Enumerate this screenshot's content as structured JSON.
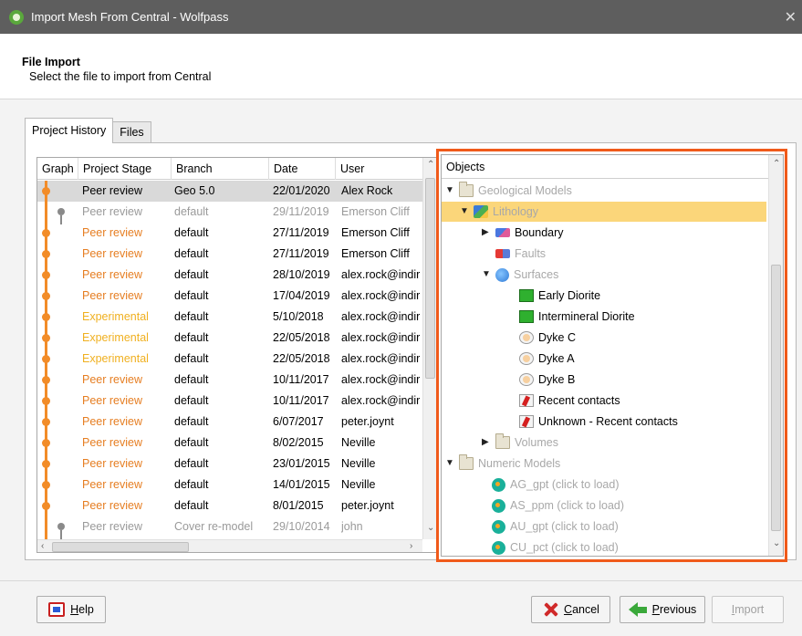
{
  "window": {
    "title": "Import Mesh From Central - Wolfpass",
    "close_icon": "close-icon"
  },
  "header": {
    "title": "File Import",
    "subtitle": "Select the file to import from Central"
  },
  "tabs": [
    {
      "label": "Project History",
      "active": true
    },
    {
      "label": "Files",
      "active": false
    }
  ],
  "history": {
    "columns": [
      "Graph",
      "Project Stage",
      "Branch",
      "Date",
      "User"
    ],
    "rows": [
      {
        "stage": "Peer review",
        "branch": "Geo 5.0",
        "date": "22/01/2020",
        "user": "Alex Rock",
        "style": "selected"
      },
      {
        "stage": "Peer review",
        "branch": "default",
        "date": "29/11/2019",
        "user": "Emerson Cliff",
        "style": "muted"
      },
      {
        "stage": "Peer review",
        "branch": "default",
        "date": "27/11/2019",
        "user": "Emerson Cliff",
        "style": "peer"
      },
      {
        "stage": "Peer review",
        "branch": "default",
        "date": "27/11/2019",
        "user": "Emerson Cliff",
        "style": "peer"
      },
      {
        "stage": "Peer review",
        "branch": "default",
        "date": "28/10/2019",
        "user": "alex.rock@indir",
        "style": "peer"
      },
      {
        "stage": "Peer review",
        "branch": "default",
        "date": "17/04/2019",
        "user": "alex.rock@indir",
        "style": "peer"
      },
      {
        "stage": "Experimental",
        "branch": "default",
        "date": "5/10/2018",
        "user": "alex.rock@indir",
        "style": "exp"
      },
      {
        "stage": "Experimental",
        "branch": "default",
        "date": "22/05/2018",
        "user": "alex.rock@indir",
        "style": "exp"
      },
      {
        "stage": "Experimental",
        "branch": "default",
        "date": "22/05/2018",
        "user": "alex.rock@indir",
        "style": "exp"
      },
      {
        "stage": "Peer review",
        "branch": "default",
        "date": "10/11/2017",
        "user": "alex.rock@indir",
        "style": "peer"
      },
      {
        "stage": "Peer review",
        "branch": "default",
        "date": "10/11/2017",
        "user": "alex.rock@indir",
        "style": "peer"
      },
      {
        "stage": "Peer review",
        "branch": "default",
        "date": "6/07/2017",
        "user": "peter.joynt",
        "style": "peer"
      },
      {
        "stage": "Peer review",
        "branch": "default",
        "date": "8/02/2015",
        "user": "Neville",
        "style": "peer"
      },
      {
        "stage": "Peer review",
        "branch": "default",
        "date": "23/01/2015",
        "user": "Neville",
        "style": "peer"
      },
      {
        "stage": "Peer review",
        "branch": "default",
        "date": "14/01/2015",
        "user": "Neville",
        "style": "peer"
      },
      {
        "stage": "Peer review",
        "branch": "default",
        "date": "8/01/2015",
        "user": "peter.joynt",
        "style": "peer"
      },
      {
        "stage": "Peer review",
        "branch": "Cover re-model",
        "date": "29/10/2014",
        "user": "john",
        "style": "muted"
      }
    ]
  },
  "objects": {
    "header": "Objects",
    "items": [
      {
        "label": "Geological Models",
        "icon": "folder-icon",
        "toggle": "▼",
        "dim": true
      },
      {
        "label": "Lithology",
        "icon": "lithology-icon",
        "toggle": "▼",
        "dim": true,
        "highlight": true
      },
      {
        "label": "Boundary",
        "icon": "boundary-icon",
        "toggle": "▶",
        "dim": false
      },
      {
        "label": "Faults",
        "icon": "faults-icon",
        "toggle": "",
        "dim": true
      },
      {
        "label": "Surfaces",
        "icon": "globe-icon",
        "toggle": "▼",
        "dim": true
      },
      {
        "label": "Early Diorite",
        "icon": "green-surface-icon",
        "toggle": "",
        "dim": false
      },
      {
        "label": "Intermineral Diorite",
        "icon": "green-surface-icon",
        "toggle": "",
        "dim": false
      },
      {
        "label": "Dyke C",
        "icon": "dyke-icon",
        "toggle": "",
        "dim": false
      },
      {
        "label": "Dyke A",
        "icon": "dyke-icon",
        "toggle": "",
        "dim": false
      },
      {
        "label": "Dyke B",
        "icon": "dyke-icon",
        "toggle": "",
        "dim": false
      },
      {
        "label": "Recent contacts",
        "icon": "contact-icon",
        "toggle": "",
        "dim": false
      },
      {
        "label": "Unknown - Recent contacts",
        "icon": "contact-icon",
        "toggle": "",
        "dim": false
      },
      {
        "label": "Volumes",
        "icon": "folder-icon",
        "toggle": "▶",
        "dim": true
      },
      {
        "label": "Numeric Models",
        "icon": "folder-icon",
        "toggle": "▼",
        "dim": true
      },
      {
        "label": "AG_gpt (click to load)",
        "icon": "numeric-model-icon",
        "toggle": "",
        "dim": true
      },
      {
        "label": "AS_ppm (click to load)",
        "icon": "numeric-model-icon",
        "toggle": "",
        "dim": true
      },
      {
        "label": "AU_gpt (click to load)",
        "icon": "numeric-model-icon",
        "toggle": "",
        "dim": true
      },
      {
        "label": "CU_pct (click to load)",
        "icon": "numeric-model-icon",
        "toggle": "",
        "dim": true
      }
    ]
  },
  "buttons": {
    "help": "Help",
    "cancel": "Cancel",
    "previous": "Previous",
    "import": "Import"
  },
  "colors": {
    "highlight_frame": "#f05a1a",
    "graph_line": "#f28c28",
    "peer_review": "#e67e22",
    "experimental": "#f0b020",
    "selection": "#fbd67a"
  }
}
